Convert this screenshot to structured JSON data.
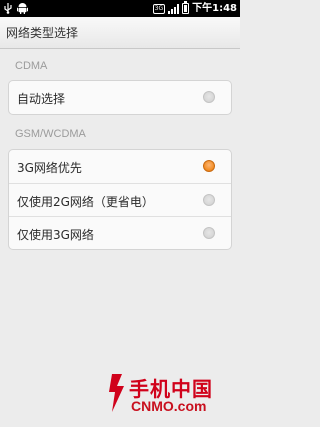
{
  "status_bar": {
    "time": "下午1:48",
    "network_type": "3G"
  },
  "header": {
    "title": "网络类型选择"
  },
  "sections": [
    {
      "title": "CDMA",
      "options": [
        {
          "label": "自动选择",
          "selected": false
        }
      ]
    },
    {
      "title": "GSM/WCDMA",
      "options": [
        {
          "label": "3G网络优先",
          "selected": true
        },
        {
          "label": "仅使用2G网络（更省电）",
          "selected": false
        },
        {
          "label": "仅使用3G网络",
          "selected": false
        }
      ]
    }
  ],
  "watermark": {
    "cn": "手机中国",
    "en": "CNMO.com",
    "color": "#d0021b"
  },
  "colors": {
    "accent": "#f28a1f",
    "background": "#ececec"
  }
}
